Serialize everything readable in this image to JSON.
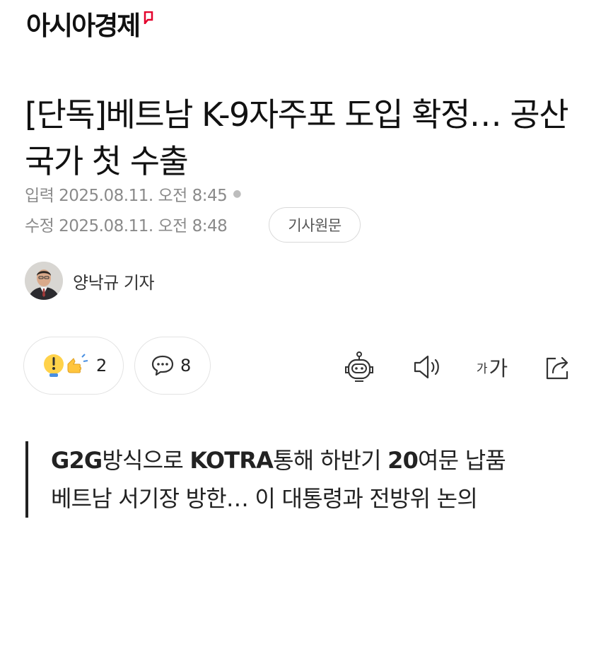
{
  "brand": {
    "name": "아시아경제",
    "accent_color": "#e4002b"
  },
  "article": {
    "headline": "[단독]베트남 K-9자주포 도입 확정… 공산국가 첫 수출",
    "published_label": "입력",
    "published_time": "2025.08.11. 오전 8:45",
    "modified_label": "수정",
    "modified_time": "2025.08.11. 오전 8:48",
    "source_button": "기사원문",
    "author": {
      "name": "양낙규 기자",
      "avatar_icon": "reporter-avatar"
    }
  },
  "actions": {
    "reaction_count": "2",
    "comment_count": "8",
    "tools": [
      "robot-summary-icon",
      "speaker-icon",
      "font-size-icon",
      "share-icon"
    ],
    "font_label_small": "가",
    "font_label_large": "가"
  },
  "summary": {
    "line1_bold_a": "G2G",
    "line1_text_a": "방식으로 ",
    "line1_bold_b": "KOTRA",
    "line1_text_b": "통해 하반기 ",
    "line1_bold_c": "20",
    "line1_text_c": "여문 납품",
    "line2": "베트남 서기장 방한… 이 대통령과 전방위 논의"
  }
}
